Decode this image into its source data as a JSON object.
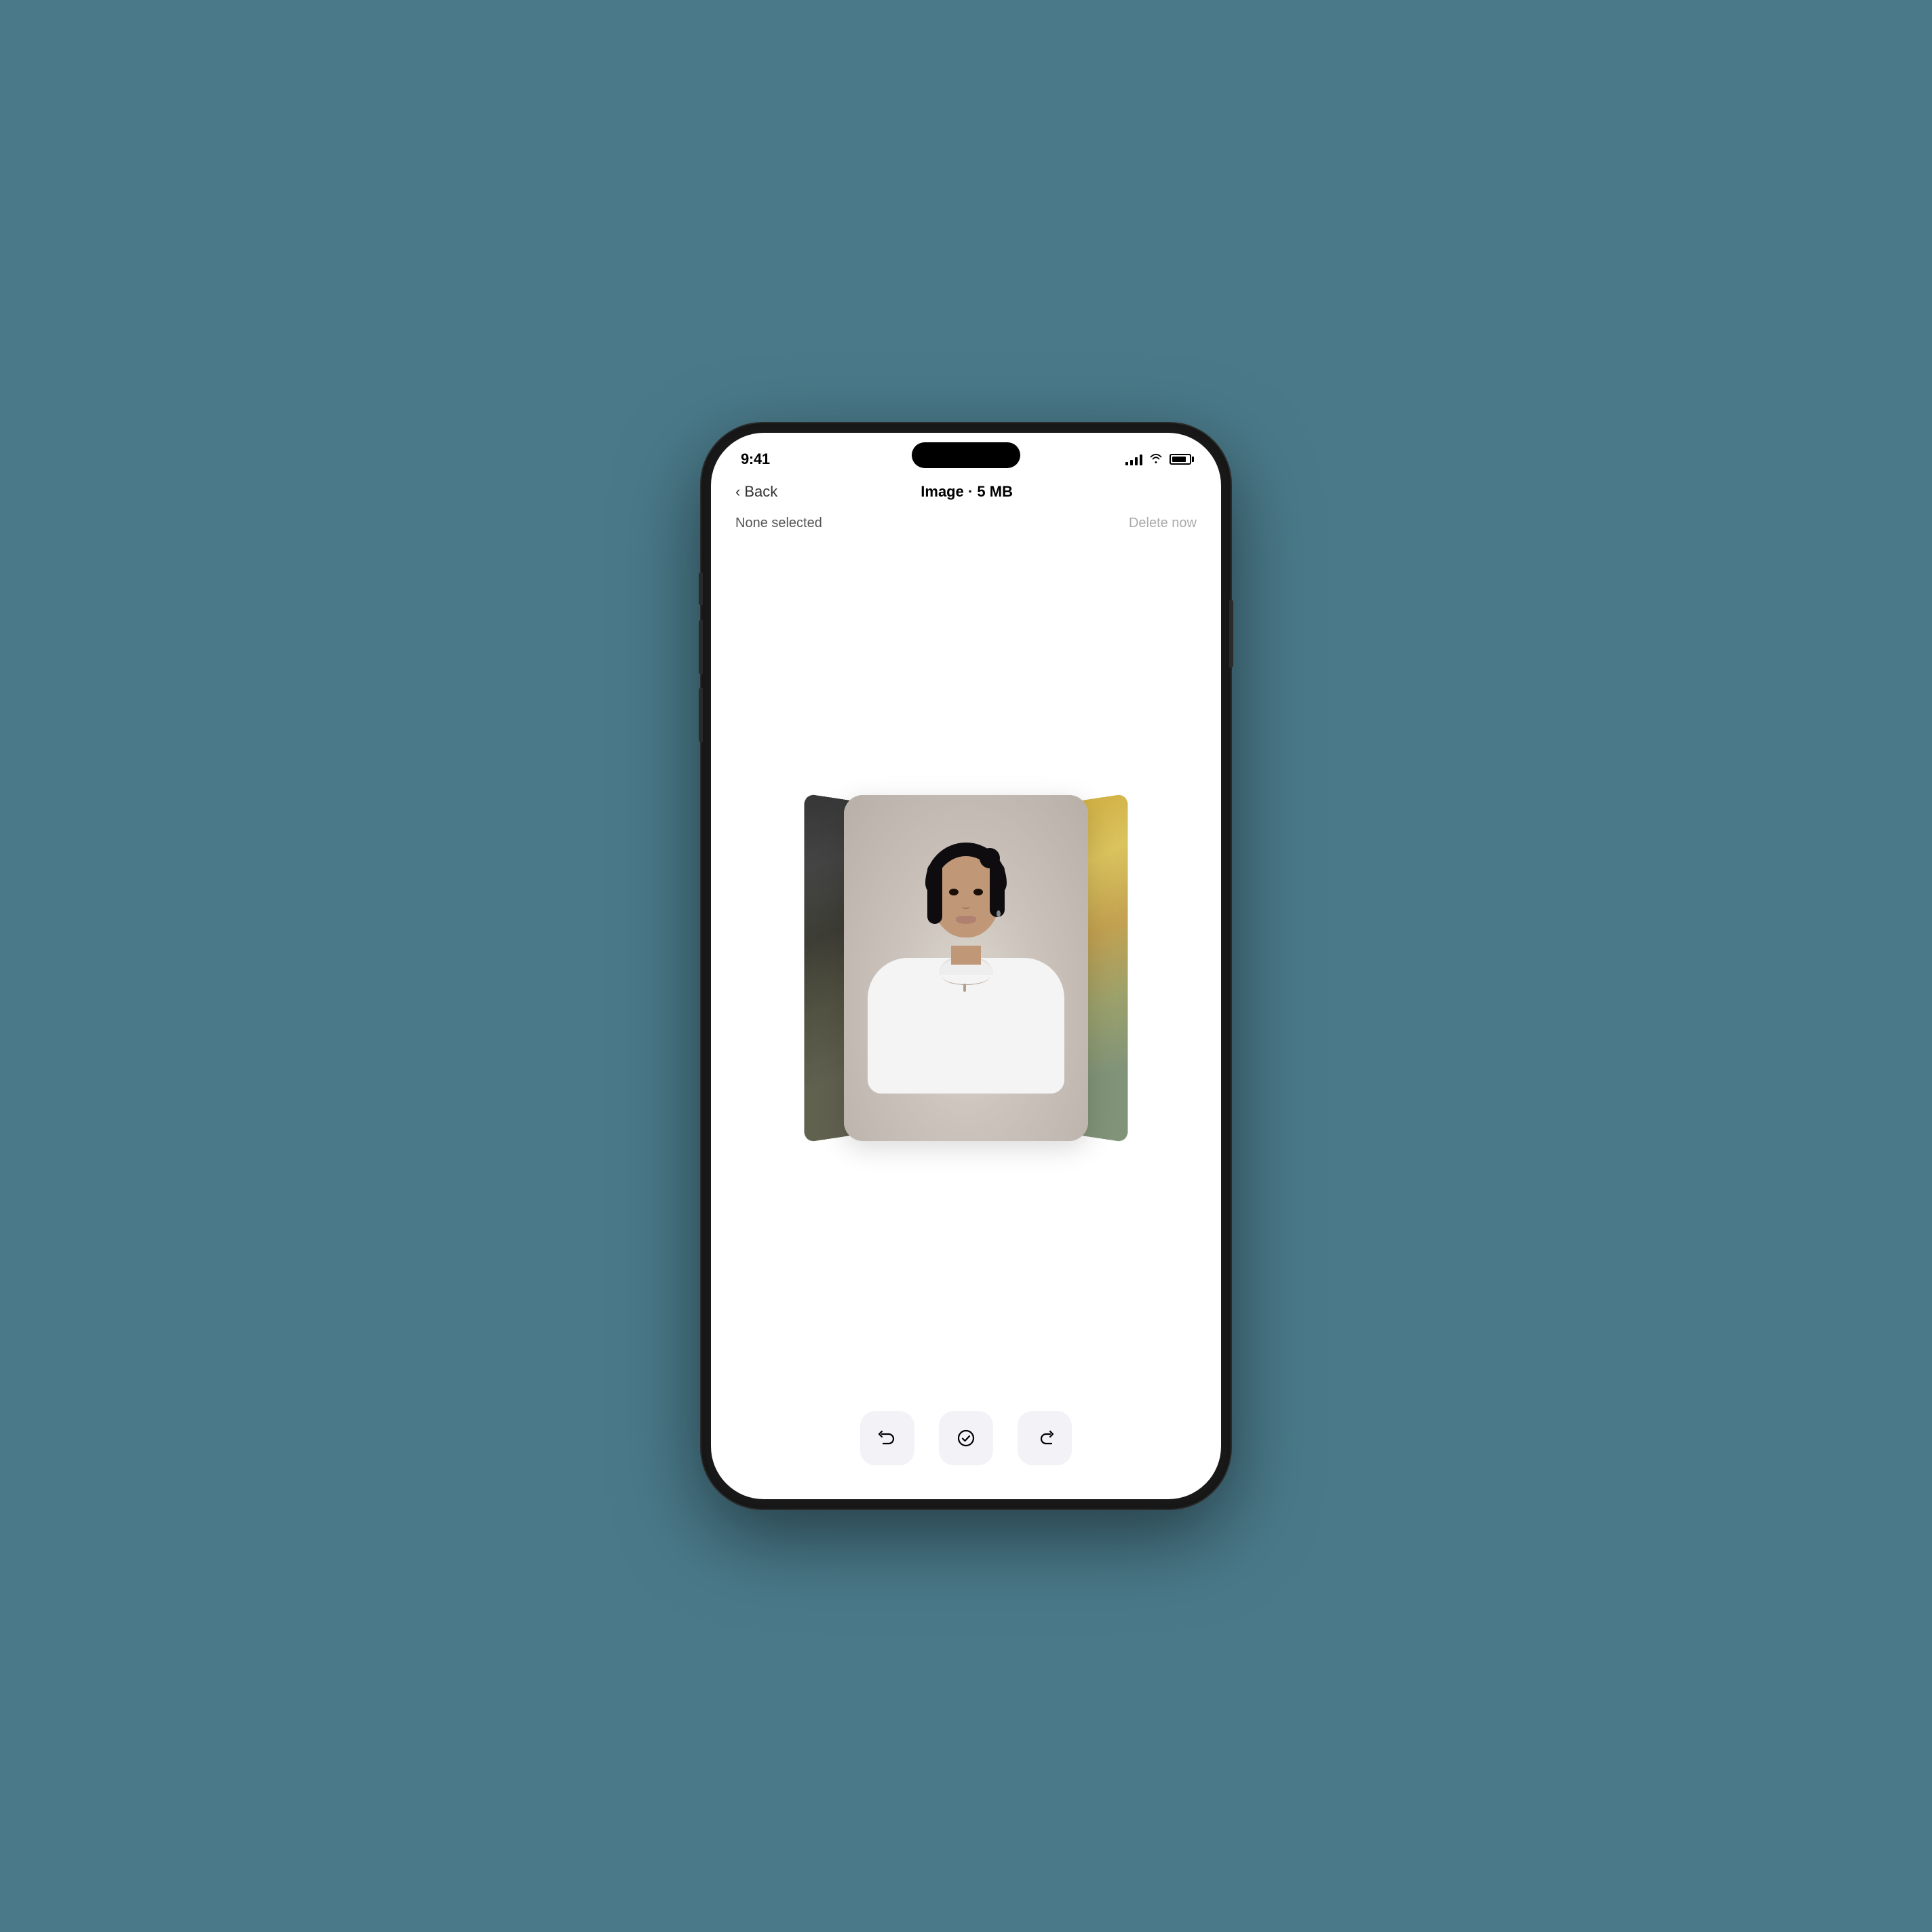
{
  "status_bar": {
    "time": "9:41",
    "signal_label": "signal",
    "wifi_label": "wifi",
    "battery_label": "battery"
  },
  "nav": {
    "back_label": "Back",
    "title": "Image · 5 MB"
  },
  "selection": {
    "none_selected_label": "None selected",
    "delete_label": "Delete now"
  },
  "toolbar": {
    "undo_label": "undo",
    "check_label": "check",
    "share_label": "share"
  }
}
